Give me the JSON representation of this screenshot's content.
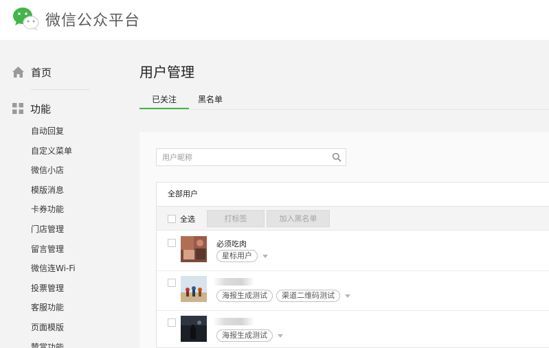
{
  "app": {
    "title": "微信公众平台"
  },
  "sidebar": {
    "home": {
      "label": "首页",
      "icon": "home-icon"
    },
    "functions": {
      "label": "功能",
      "icon": "grid-icon"
    },
    "items": [
      "自动回复",
      "自定义菜单",
      "微信小店",
      "模版消息",
      "卡券功能",
      "门店管理",
      "留言管理",
      "微信连Wi-Fi",
      "投票管理",
      "客服功能",
      "页面模版",
      "赞赏功能"
    ]
  },
  "main": {
    "title": "用户管理",
    "tabs": [
      "已关注",
      "黑名单"
    ],
    "search": {
      "placeholder": "用户昵称"
    },
    "list_title": "全部用户",
    "toolbar": {
      "select_all": "全选",
      "tag_button": "打标签",
      "blacklist_button": "加入黑名单"
    },
    "users": [
      {
        "name": "必须吃肉",
        "tags": [
          "星标用户"
        ]
      },
      {
        "name": "",
        "tags": [
          "海报生成测试",
          "渠道二维码测试"
        ]
      },
      {
        "name": "",
        "tags": [
          "海报生成测试"
        ]
      }
    ]
  },
  "colors": {
    "accent": "#44b549",
    "background": "#f3f3f3"
  }
}
